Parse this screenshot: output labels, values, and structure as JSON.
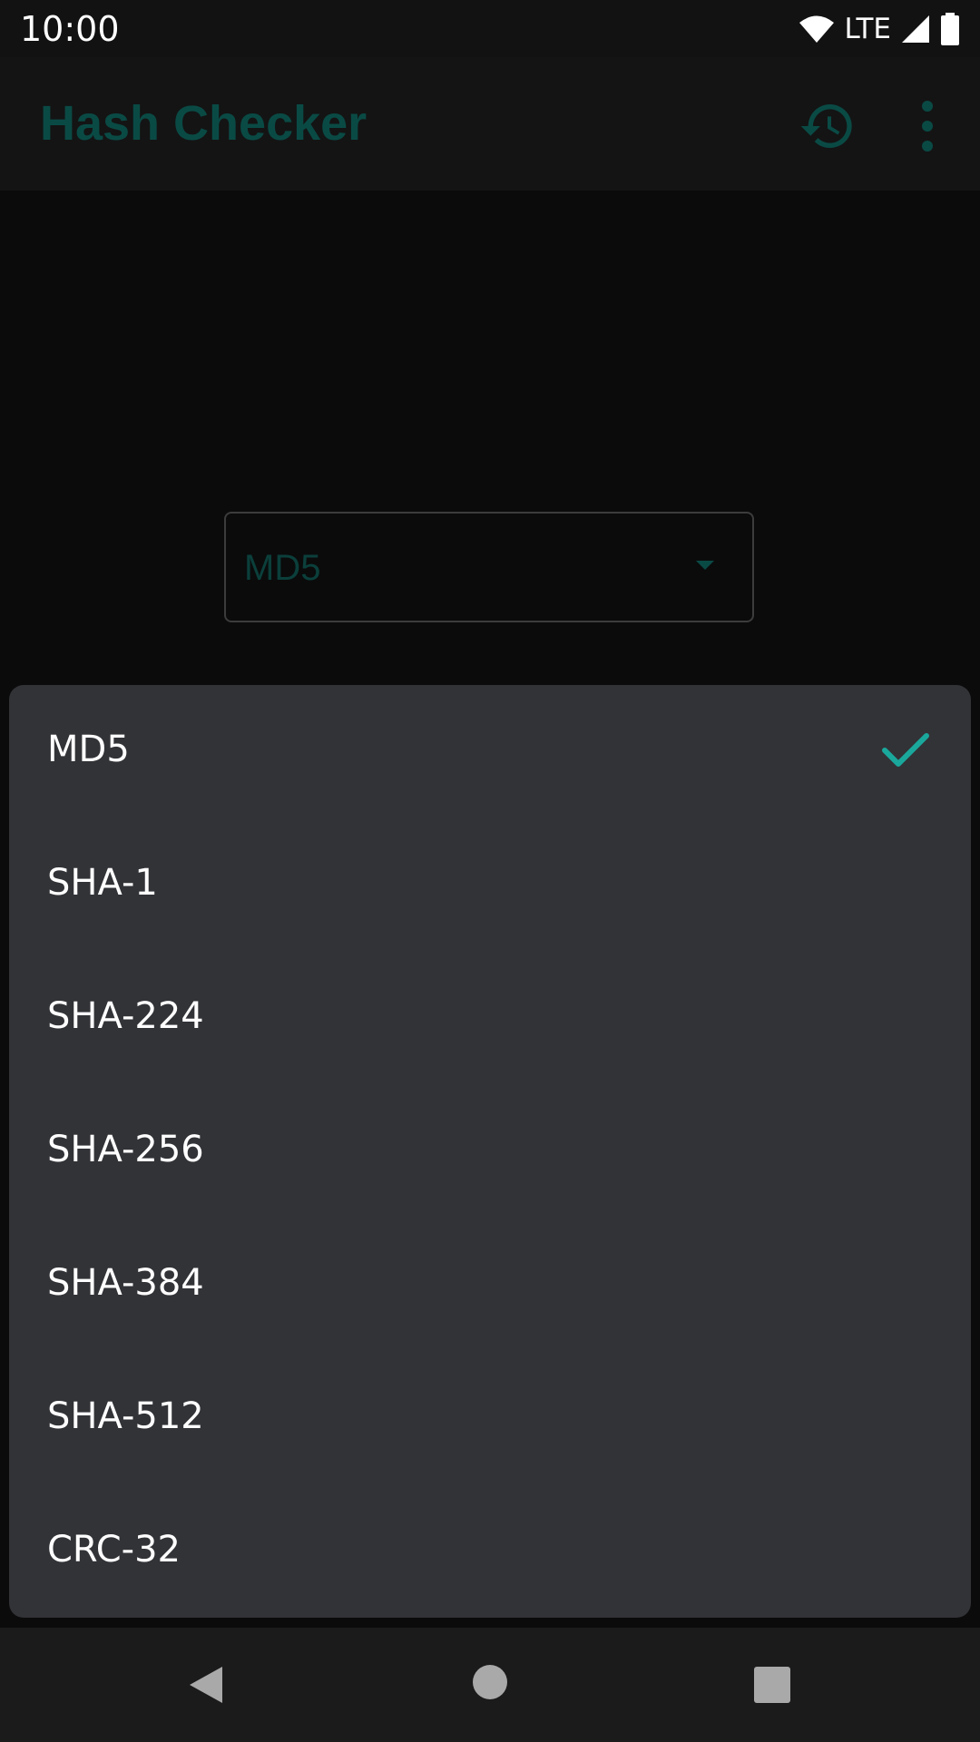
{
  "status_bar": {
    "time": "10:00",
    "network": "LTE",
    "icons": [
      "wifi-icon",
      "cellular-signal-icon",
      "battery-icon"
    ]
  },
  "app_bar": {
    "title": "Hash Checker",
    "actions": [
      "history-icon",
      "more-vert-icon"
    ]
  },
  "algorithm_select": {
    "selected": "MD5",
    "icon": "dropdown-arrow-icon"
  },
  "dropdown": {
    "options": [
      {
        "label": "MD5",
        "selected": true
      },
      {
        "label": "SHA-1",
        "selected": false
      },
      {
        "label": "SHA-224",
        "selected": false
      },
      {
        "label": "SHA-256",
        "selected": false
      },
      {
        "label": "SHA-384",
        "selected": false
      },
      {
        "label": "SHA-512",
        "selected": false
      },
      {
        "label": "CRC-32",
        "selected": false
      }
    ]
  },
  "nav_bar": {
    "icons": [
      "back-icon",
      "home-icon",
      "recents-icon"
    ]
  },
  "colors": {
    "accent": "#1aa89c",
    "dim_accent": "#0a4a45",
    "menu_bg": "#323337",
    "app_bar_bg": "#141414"
  }
}
